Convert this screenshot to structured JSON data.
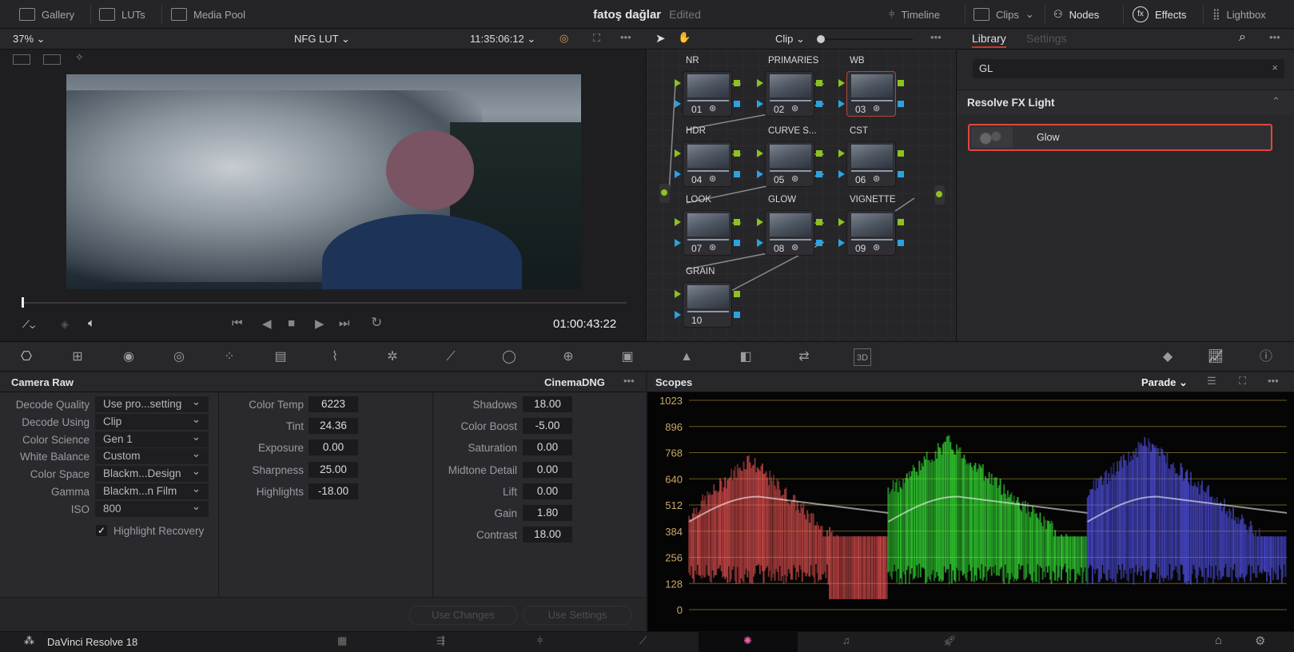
{
  "topbar": {
    "gallery": "Gallery",
    "luts": "LUTs",
    "media_pool": "Media Pool",
    "project": "fatoş dağlar",
    "status": "Edited",
    "timeline": "Timeline",
    "clips": "Clips",
    "nodes": "Nodes",
    "effects": "Effects",
    "lightbox": "Lightbox"
  },
  "viewer": {
    "zoom": "37%",
    "lut": "NFG LUT",
    "timecode_top": "11:35:06:12",
    "timecode": "01:00:43:22",
    "playhead_fraction": 0.0
  },
  "node_editor": {
    "mode": "Clip",
    "nodes": [
      {
        "label": "NR",
        "num": "01",
        "icon": "noise-icon"
      },
      {
        "label": "PRIMARIES",
        "num": "02",
        "icon": "bars-icon"
      },
      {
        "label": "WB",
        "num": "03",
        "icon": "bars-icon",
        "selected": true
      },
      {
        "label": "HDR",
        "num": "04",
        "icon": "hdr-icon"
      },
      {
        "label": "CURVE S...",
        "num": "05",
        "icon": "curve-icon"
      },
      {
        "label": "CST",
        "num": "06",
        "icon": "fx-icon"
      },
      {
        "label": "LOOK",
        "num": "07",
        "icon": "lut-grid-icon"
      },
      {
        "label": "GLOW",
        "num": "08",
        "icon": "fx-icon"
      },
      {
        "label": "VIGNETTE",
        "num": "09",
        "icon": "curve-window-icon"
      },
      {
        "label": "GRAIN",
        "num": "10",
        "icon": ""
      }
    ]
  },
  "library": {
    "tab_library": "Library",
    "tab_settings": "Settings",
    "search_value": "GL",
    "section": "Resolve FX Light",
    "result": "Glow",
    "accent": "#e0473a"
  },
  "camera_raw": {
    "title": "Camera Raw",
    "format": "CinemaDNG",
    "left": [
      {
        "label": "Decode Quality",
        "value": "Use pro...setting"
      },
      {
        "label": "Decode Using",
        "value": "Clip"
      },
      {
        "label": "Color Science",
        "value": "Gen 1"
      },
      {
        "label": "White Balance",
        "value": "Custom"
      },
      {
        "label": "Color Space",
        "value": "Blackm...Design"
      },
      {
        "label": "Gamma",
        "value": "Blackm...n Film"
      },
      {
        "label": "ISO",
        "value": "800"
      }
    ],
    "highlight_recovery": "Highlight Recovery",
    "mid": [
      {
        "label": "Color Temp",
        "value": "6223"
      },
      {
        "label": "Tint",
        "value": "24.36"
      },
      {
        "label": "Exposure",
        "value": "0.00"
      },
      {
        "label": "Sharpness",
        "value": "25.00"
      },
      {
        "label": "Highlights",
        "value": "-18.00"
      }
    ],
    "right": [
      {
        "label": "Shadows",
        "value": "18.00"
      },
      {
        "label": "Color Boost",
        "value": "-5.00"
      },
      {
        "label": "Saturation",
        "value": "0.00"
      },
      {
        "label": "Midtone Detail",
        "value": "0.00"
      },
      {
        "label": "Lift",
        "value": "0.00"
      },
      {
        "label": "Gain",
        "value": "1.80"
      },
      {
        "label": "Contrast",
        "value": "18.00"
      }
    ],
    "use_changes": "Use Changes",
    "use_settings": "Use Settings"
  },
  "scopes": {
    "title": "Scopes",
    "mode": "Parade",
    "ticks": [
      "1023",
      "896",
      "768",
      "640",
      "512",
      "384",
      "256",
      "128",
      "0"
    ],
    "colors": {
      "red": "#ff5a5a",
      "green": "#3cff3c",
      "blue": "#5a5aff",
      "grid": "#6b5a22"
    }
  },
  "footer": {
    "app": "DaVinci Resolve 18"
  }
}
